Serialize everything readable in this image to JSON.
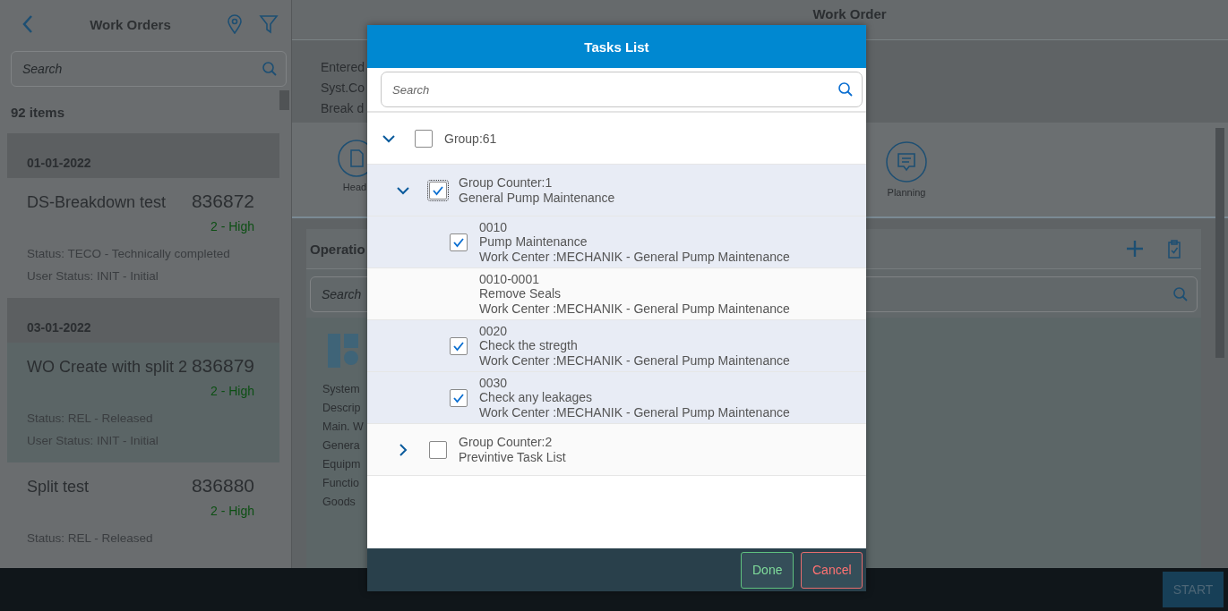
{
  "master": {
    "title": "Work Orders",
    "search": {
      "placeholder": "Search"
    },
    "count": "92 items",
    "groups": [
      {
        "date": "01-01-2022",
        "orders": [
          {
            "title": "DS-Breakdown test",
            "number": "836872",
            "priority": "2 - High",
            "status": "Status: TECO - Technically completed",
            "user_status": "User Status: INIT - Initial",
            "selected": false
          }
        ]
      },
      {
        "date": "03-01-2022",
        "orders": [
          {
            "title": "WO Create with split 2",
            "number": "836879",
            "priority": "2 - High",
            "status": "Status: REL - Released",
            "user_status": "User Status: INIT - Initial",
            "selected": true
          },
          {
            "title": "Split test",
            "number": "836880",
            "priority": "2 - High",
            "status": "Status: REL - Released",
            "selected": false
          }
        ]
      }
    ]
  },
  "detail": {
    "title": "Work Order",
    "info_labels": [
      "Entered",
      "Syst.Co",
      "Break d"
    ],
    "tabs": [
      {
        "label": "Head"
      },
      {
        "label": "Planning"
      }
    ],
    "operations": {
      "title": "Operatio",
      "search": {
        "placeholder": "Search"
      },
      "labels": [
        "System",
        "Descrip",
        "Main. W",
        "Genera",
        "Equipm",
        "Functio",
        "Goods"
      ]
    },
    "start_button": "START"
  },
  "dialog": {
    "title": "Tasks List",
    "search": {
      "placeholder": "Search"
    },
    "tree": [
      {
        "label": "Group:61",
        "expanded": true,
        "checked": false,
        "children": [
          {
            "title": "Group Counter:1",
            "subtitle": "General Pump Maintenance",
            "expanded": true,
            "checked": true,
            "children": [
              {
                "kind": "operation",
                "number": "0010",
                "name": "Pump Maintenance",
                "work_center": "Work Center :MECHANIK - General Pump Maintenance",
                "checked": true
              },
              {
                "kind": "sub_operation",
                "number": "0010-0001",
                "name": "Remove Seals",
                "work_center": "Work Center :MECHANIK - General Pump Maintenance"
              },
              {
                "kind": "operation",
                "number": "0020",
                "name": "Check the stregth",
                "work_center": "Work Center :MECHANIK - General Pump Maintenance",
                "checked": true
              },
              {
                "kind": "operation",
                "number": "0030",
                "name": "Check any leakages",
                "work_center": "Work Center :MECHANIK - General Pump Maintenance",
                "checked": true
              }
            ]
          },
          {
            "title": "Group Counter:2",
            "subtitle": "Previntive Task List",
            "expanded": false,
            "checked": false
          }
        ]
      }
    ],
    "buttons": [
      {
        "kind": "confirm",
        "label": "Done"
      },
      {
        "kind": "cancel",
        "label": "Cancel"
      }
    ]
  }
}
